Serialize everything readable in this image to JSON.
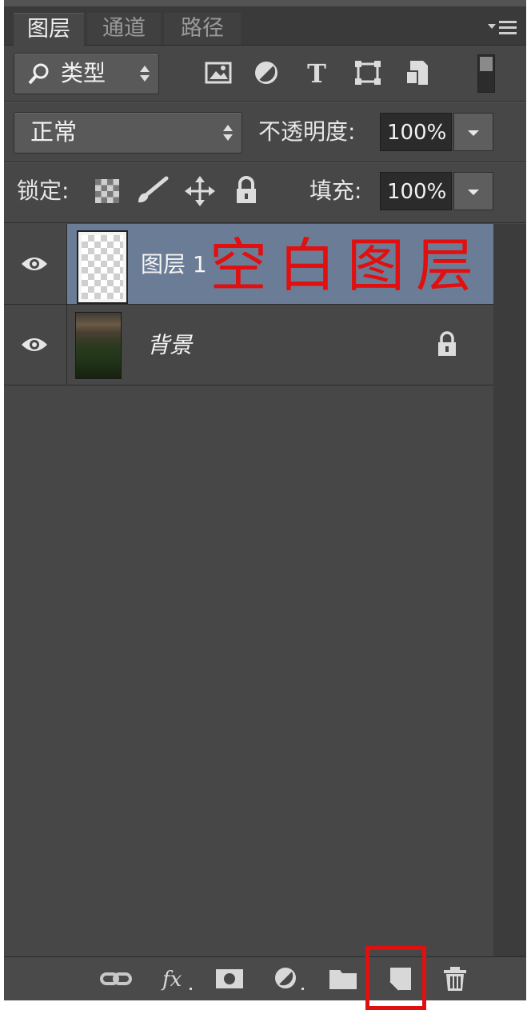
{
  "tabs": [
    {
      "label": "图层",
      "active": true
    },
    {
      "label": "通道",
      "active": false
    },
    {
      "label": "路径",
      "active": false
    }
  ],
  "filter": {
    "label": "类型",
    "icons": [
      "image-filter-icon",
      "adjustment-filter-icon",
      "type-filter-icon",
      "shape-filter-icon",
      "smart-object-filter-icon"
    ]
  },
  "blend": {
    "mode": "正常",
    "opacity_label": "不透明度:",
    "opacity_value": "100%"
  },
  "lock": {
    "label": "锁定:",
    "fill_label": "填充:",
    "fill_value": "100%"
  },
  "layers": [
    {
      "name": "图层 1",
      "selected": true,
      "visible": true
    },
    {
      "name": "背景",
      "selected": false,
      "visible": true,
      "locked": true
    }
  ],
  "annotation": "空白图层",
  "bottom_toolbar": [
    "link-layers-icon",
    "fx-icon",
    "layer-mask-icon",
    "adjustment-layer-icon",
    "group-folder-icon",
    "new-layer-icon",
    "trash-icon"
  ],
  "colors": {
    "panel": "#474747",
    "selected_row": "#6b7d96",
    "annotation_red": "#e01010"
  }
}
